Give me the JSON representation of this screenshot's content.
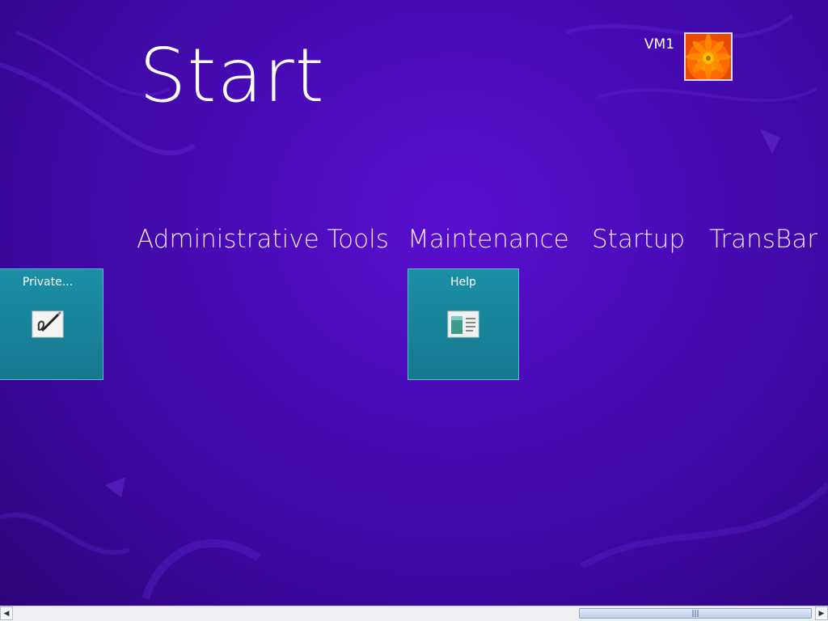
{
  "screen": {
    "title": "Start"
  },
  "user": {
    "name": "VM1"
  },
  "groups": [
    {
      "label": "Administrative Tools"
    },
    {
      "label": "Maintenance"
    },
    {
      "label": "Startup"
    },
    {
      "label": "TransBar"
    }
  ],
  "tiles": [
    {
      "label": "Private...",
      "icon": "document-pen-icon",
      "color": "#1b8fa6"
    },
    {
      "label": "Help",
      "icon": "help-book-icon",
      "color": "#1b8fa6"
    }
  ],
  "scrollbar": {
    "thumb_grip": "|||"
  },
  "colors": {
    "background": "#4a0bb8",
    "tile": "#1b8fa6"
  }
}
